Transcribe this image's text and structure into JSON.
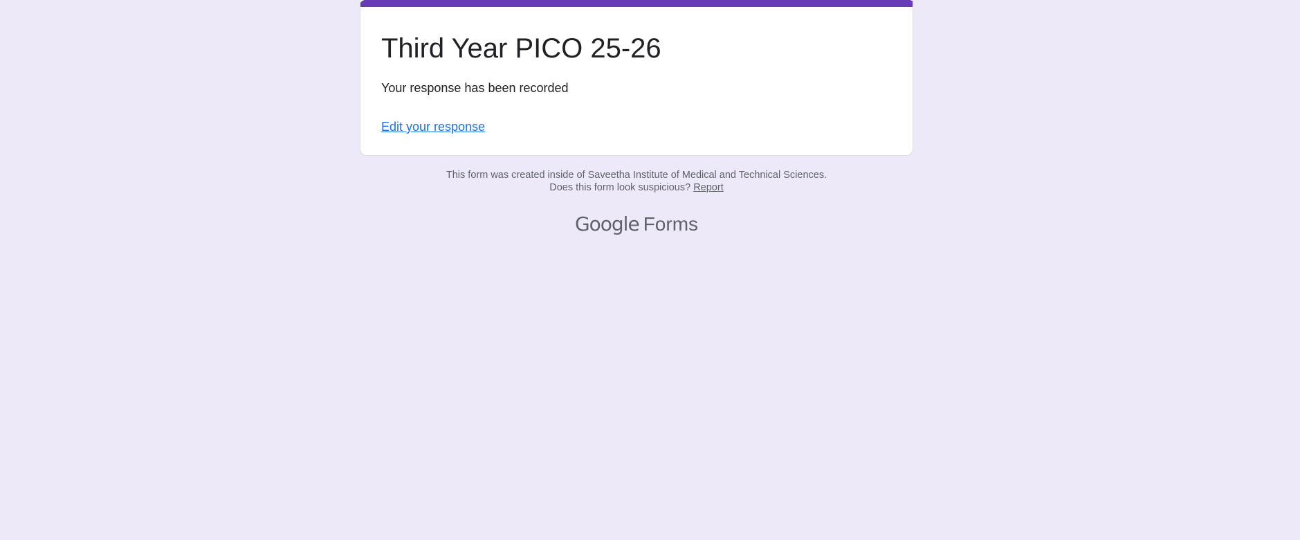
{
  "form": {
    "title": "Third Year PICO 25-26",
    "confirmation_message": "Your response has been recorded",
    "edit_link_label": "Edit your response"
  },
  "footer": {
    "created_inside_text": "This form was created inside of Saveetha Institute of Medical and Technical Sciences.",
    "suspicious_text": "Does this form look suspicious?",
    "report_link_label": "Report"
  },
  "brand": {
    "google_text": "Google",
    "forms_text": "Forms"
  },
  "colors": {
    "page_background": "#ede9f8",
    "accent_bar": "#673ab7",
    "link": "#1a73e8",
    "text_primary": "#202124",
    "text_secondary": "#5f6368"
  }
}
